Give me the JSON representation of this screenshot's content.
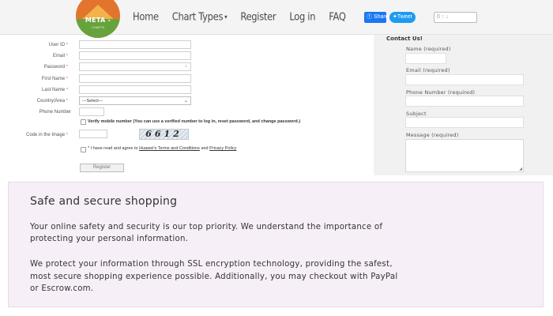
{
  "header": {
    "logo_text": "META -",
    "logo_subtext": "CHARTS",
    "nav": [
      "Home",
      "Chart Types",
      "Register",
      "Log in",
      "FAQ"
    ],
    "share_label": "Share",
    "tweet_label": "Tweet",
    "vote_label": "0 ↑ ↓"
  },
  "form": {
    "fields": [
      {
        "label": "User ID",
        "required": "*"
      },
      {
        "label": "Email",
        "required": "*"
      },
      {
        "label": "Password",
        "required": "*"
      },
      {
        "label": "First Name",
        "required": "*"
      },
      {
        "label": "Last Name",
        "required": "*"
      },
      {
        "label": "Country/Area",
        "required": "*"
      },
      {
        "label": "Phone Number",
        "required": ""
      }
    ],
    "country_selected": "---Select---",
    "verify_text": "Verify mobile number (You can use a verified number to log in, reset password, and change password.)",
    "captcha_label": "Code in the Image",
    "captcha_required": "*",
    "captcha_code": "6612",
    "agree_prefix": "* I have read and agree to",
    "terms_link": "Huawei's Terms and Conditions",
    "and": "and",
    "privacy_link": "Privacy Policy",
    "register_label": "Register"
  },
  "contact": {
    "title": "Contact Us!",
    "name_label": "Name (required)",
    "email_label": "Email (required)",
    "phone_label": "Phone Number (required)",
    "subject_label": "Subject",
    "message_label": "Message (required)"
  },
  "safe": {
    "title": "Safe and secure shopping",
    "p1_line1": "Your online safety and security is our top priority. We understand the importance of",
    "p1_line2": "protecting your personal information.",
    "p2_line1": "We protect your information through SSL encryption technology, providing the safest,",
    "p2_line2": "most secure shopping experience possible. Additionally, you may checkout with PayPal",
    "p2_line3": "or Escrow.com."
  },
  "colors": {
    "logo_orange": "#e2742e",
    "logo_green": "#67a33c",
    "share_blue": "#1877f2",
    "tweet_blue": "#1d9bf0",
    "safe_bg": "#f7eff7"
  }
}
